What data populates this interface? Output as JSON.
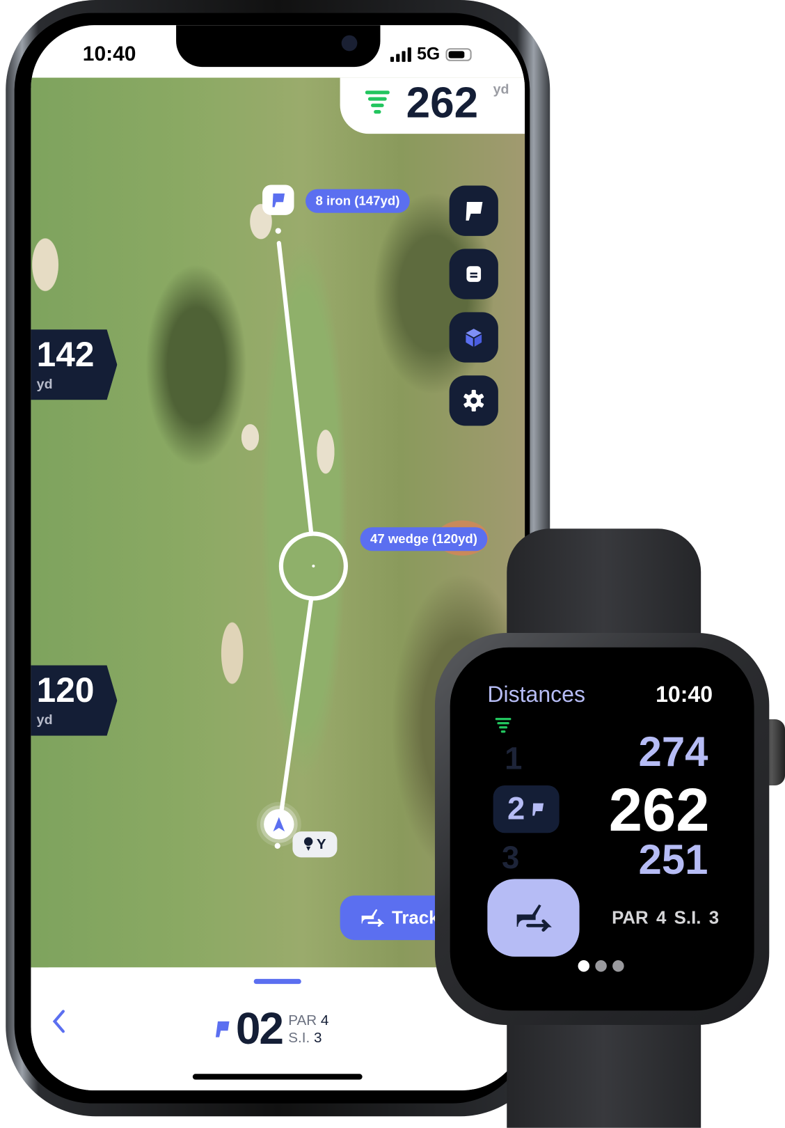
{
  "phone": {
    "status": {
      "time": "10:40",
      "network": "5G"
    },
    "distance_header": {
      "value": "262",
      "unit": "yd",
      "icon": "signal-funnel-icon",
      "icon_color": "#22c55e"
    },
    "left_tags": [
      {
        "value": "142",
        "unit": "yd"
      },
      {
        "value": "120",
        "unit": "yd"
      }
    ],
    "club_labels": [
      "8 iron (147yd)",
      "47 wedge (120yd)"
    ],
    "tools": [
      {
        "name": "flag-icon"
      },
      {
        "name": "scorecard-icon"
      },
      {
        "name": "3d-cube-icon"
      },
      {
        "name": "gear-icon"
      }
    ],
    "tee_label": "Y",
    "track_button": "Track",
    "hole": {
      "number": "02",
      "par_label": "PAR",
      "par": "4",
      "si_label": "S.I.",
      "si": "3"
    },
    "colors": {
      "accent": "#5b6ff0",
      "navy": "#141e36"
    }
  },
  "watch": {
    "title": "Distances",
    "time": "10:40",
    "holes": [
      "1",
      "2",
      "3"
    ],
    "distances": {
      "back": "274",
      "middle": "262",
      "front": "251"
    },
    "info": "PAR 4  S.I. 3",
    "page_dots": {
      "count": 3,
      "active": 1
    },
    "accent": "#b6bcf5"
  }
}
